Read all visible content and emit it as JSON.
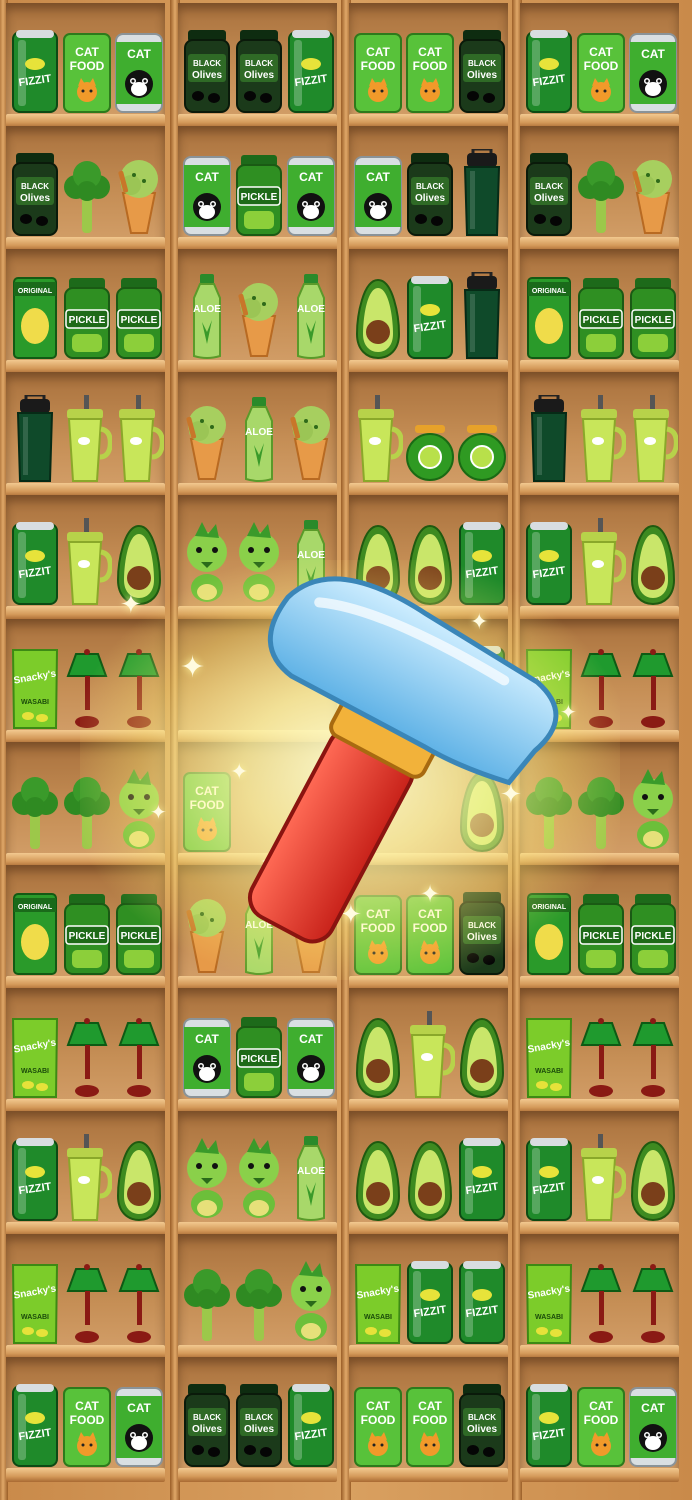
{
  "game": {
    "title": "",
    "columns": 4,
    "rows": 12,
    "active_booster": "hammer",
    "shelves": [
      [
        [
          "soda",
          "catfood",
          "catcan"
        ],
        [
          "olives",
          "olives",
          "soda"
        ],
        [
          "catfood",
          "catfood",
          "olives"
        ],
        [
          "soda",
          "catfood",
          "catcan"
        ]
      ],
      [
        [
          "olives",
          "broccoli",
          "icecream"
        ],
        [
          "catcan",
          "pickle",
          "catcan"
        ],
        [
          "catcan",
          "olives",
          "tumbler"
        ],
        [
          "olives",
          "broccoli",
          "icecream"
        ]
      ],
      [
        [
          "chips-original",
          "pickle",
          "pickle"
        ],
        [
          "aloe",
          "icecream",
          "aloe"
        ],
        [
          "avocado",
          "soda",
          "tumbler"
        ],
        [
          "chips-original",
          "pickle",
          "pickle"
        ]
      ],
      [
        [
          "tumbler",
          "cup",
          "cup"
        ],
        [
          "icecream",
          "aloe",
          "icecream"
        ],
        [
          "cup",
          "jar",
          "jar"
        ],
        [
          "tumbler",
          "cup",
          "cup"
        ]
      ],
      [
        [
          "soda",
          "cup",
          "avocado"
        ],
        [
          "dino",
          "dino",
          "aloe"
        ],
        [
          "avocado",
          "avocado",
          "soda"
        ],
        [
          "soda",
          "cup",
          "avocado"
        ]
      ],
      [
        [
          "snacky",
          "lamp",
          "lamp"
        ],
        [
          "",
          "",
          ""
        ],
        [
          "",
          "",
          "soda"
        ],
        [
          "snacky",
          "lamp",
          "lamp"
        ]
      ],
      [
        [
          "broccoli",
          "broccoli",
          "dino"
        ],
        [
          "catfood",
          "",
          ""
        ],
        [
          "",
          "",
          "avocado"
        ],
        [
          "broccoli",
          "broccoli",
          "dino"
        ]
      ],
      [
        [
          "chips-original",
          "pickle",
          "pickle"
        ],
        [
          "icecream",
          "aloe",
          "icecream"
        ],
        [
          "catfood",
          "catfood",
          "olives"
        ],
        [
          "chips-original",
          "pickle",
          "pickle"
        ]
      ],
      [
        [
          "snacky",
          "lamp",
          "lamp"
        ],
        [
          "catcan",
          "pickle",
          "catcan"
        ],
        [
          "avocado",
          "cup",
          "avocado"
        ],
        [
          "snacky",
          "lamp",
          "lamp"
        ]
      ],
      [
        [
          "soda",
          "cup",
          "avocado"
        ],
        [
          "dino",
          "dino",
          "aloe"
        ],
        [
          "avocado",
          "avocado",
          "soda"
        ],
        [
          "soda",
          "cup",
          "avocado"
        ]
      ],
      [
        [
          "snacky",
          "lamp",
          "lamp"
        ],
        [
          "broccoli",
          "broccoli",
          "dino"
        ],
        [
          "snacky",
          "soda",
          "soda"
        ],
        [
          "snacky",
          "lamp",
          "lamp"
        ]
      ],
      [
        [
          "soda",
          "catfood",
          "catcan"
        ],
        [
          "olives",
          "olives",
          "soda"
        ],
        [
          "catfood",
          "catfood",
          "olives"
        ],
        [
          "soda",
          "catfood",
          "catcan"
        ]
      ]
    ]
  },
  "labels": {
    "soda": "FIZZIT",
    "catfood": [
      "CAT",
      "FOOD"
    ],
    "catcan": "CAT",
    "olives": [
      "BLACK",
      "Olives"
    ],
    "pickle": "PICKLE",
    "aloe": "ALOE",
    "chips_original": "ORIGINAL",
    "snacky": [
      "Snacky's",
      "WASABI"
    ]
  },
  "colors": {
    "soda": "#1f8a2a",
    "catfood": "#58c23a",
    "olives": "#1b3a1a",
    "pickle": "#2f8f22",
    "avocado": "#3d8a20",
    "tumbler": "#0f4a2a",
    "cup": "#c8e65a",
    "lamp_shade": "#1f9a2e",
    "lamp_base": "#8a1a14",
    "hammer_head": "#8fd0f2",
    "hammer_handle": "#e03428"
  }
}
